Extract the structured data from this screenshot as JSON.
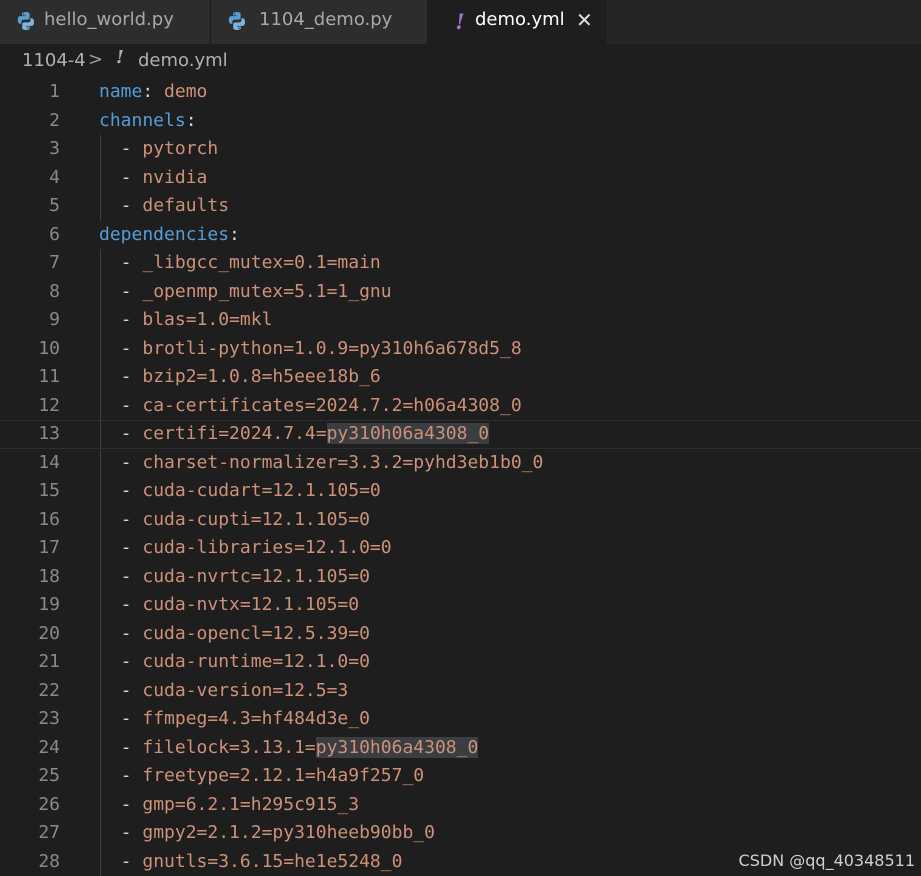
{
  "tabs": [
    {
      "label": "hello_world.py",
      "icon": "python-file-icon",
      "active": false
    },
    {
      "label": "1104_demo.py",
      "icon": "python-file-icon",
      "active": false
    },
    {
      "label": "demo.yml",
      "icon": "yaml-file-icon",
      "icon_glyph": "!",
      "active": true
    }
  ],
  "close_glyph": "✕",
  "breadcrumb": {
    "folder": "1104-4",
    "separator": ">",
    "file_icon_glyph": "!",
    "file": "demo.yml"
  },
  "editor": {
    "line_numbers": [
      "1",
      "2",
      "3",
      "4",
      "5",
      "6",
      "7",
      "8",
      "9",
      "10",
      "11",
      "12",
      "13",
      "14",
      "15",
      "16",
      "17",
      "18",
      "19",
      "20",
      "21",
      "22",
      "23",
      "24",
      "25",
      "26",
      "27",
      "28"
    ],
    "lines": {
      "l1_key": "name",
      "l1_colon": ":",
      "l1_val": "demo",
      "l2_key": "channels",
      "l2_colon": ":",
      "l3_dash": "  - ",
      "l3_val": "pytorch",
      "l4_dash": "  - ",
      "l4_val": "nvidia",
      "l5_dash": "  - ",
      "l5_val": "defaults",
      "l6_key": "dependencies",
      "l6_colon": ":",
      "l7_dash": "  - ",
      "l7_val": "_libgcc_mutex=0.1=main",
      "l8_dash": "  - ",
      "l8_val": "_openmp_mutex=5.1=1_gnu",
      "l9_dash": "  - ",
      "l9_val": "blas=1.0=mkl",
      "l10_dash": "  - ",
      "l10_val": "brotli-python=1.0.9=py310h6a678d5_8",
      "l11_dash": "  - ",
      "l11_val": "bzip2=1.0.8=h5eee18b_6",
      "l12_dash": "  - ",
      "l12_val": "ca-certificates=2024.7.2=h06a4308_0",
      "l13_dash": "  - ",
      "l13_val_a": "certifi=2024.7.4=",
      "l13_val_hl": "py310h06a4308_0",
      "l14_dash": "  - ",
      "l14_val": "charset-normalizer=3.3.2=pyhd3eb1b0_0",
      "l15_dash": "  - ",
      "l15_val": "cuda-cudart=12.1.105=0",
      "l16_dash": "  - ",
      "l16_val": "cuda-cupti=12.1.105=0",
      "l17_dash": "  - ",
      "l17_val": "cuda-libraries=12.1.0=0",
      "l18_dash": "  - ",
      "l18_val": "cuda-nvrtc=12.1.105=0",
      "l19_dash": "  - ",
      "l19_val": "cuda-nvtx=12.1.105=0",
      "l20_dash": "  - ",
      "l20_val": "cuda-opencl=12.5.39=0",
      "l21_dash": "  - ",
      "l21_val": "cuda-runtime=12.1.0=0",
      "l22_dash": "  - ",
      "l22_val": "cuda-version=12.5=3",
      "l23_dash": "  - ",
      "l23_val": "ffmpeg=4.3=hf484d3e_0",
      "l24_dash": "  - ",
      "l24_val_a": "filelock=3.13.1=",
      "l24_val_hl": "py310h06a4308_0",
      "l25_dash": "  - ",
      "l25_val": "freetype=2.12.1=h4a9f257_0",
      "l26_dash": "  - ",
      "l26_val": "gmp=6.2.1=h295c915_3",
      "l27_dash": "  - ",
      "l27_val": "gmpy2=2.1.2=py310heeb90bb_0",
      "l28_dash": "  - ",
      "l28_val": "gnutls=3.6.15=he1e5248_0"
    },
    "colors": {
      "key": "#569cd6",
      "string": "#ce9178",
      "background": "#1e1e1e",
      "line_number": "#8a8a8a",
      "selection_highlight": "#3a3d41"
    }
  },
  "watermark": "CSDN @qq_40348511"
}
